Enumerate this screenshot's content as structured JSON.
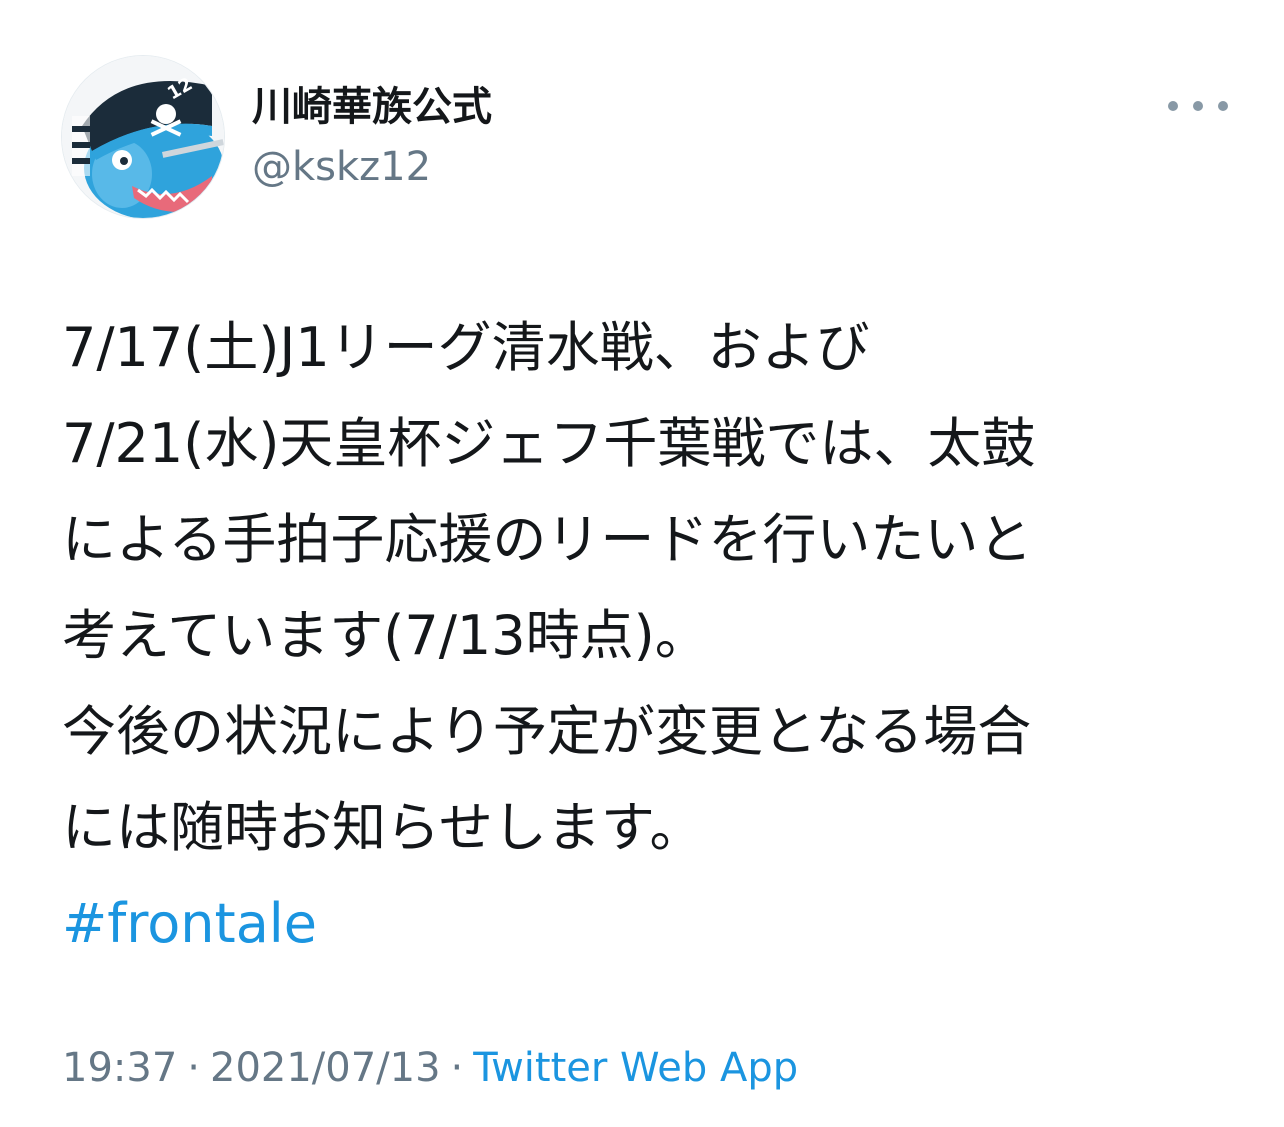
{
  "author": {
    "display_name": "川崎華族公式",
    "handle": "@kskz12",
    "avatar_icon": "pirate-mascot-avatar",
    "avatar_label": "12"
  },
  "more_icon": "more-horizontal-icon",
  "tweet": {
    "lines": [
      "7/17(土)J1リーグ清水戦、および",
      "7/21(水)天皇杯ジェフ千葉戦では、太鼓",
      "による手拍子応援のリードを行いたいと",
      "考えています(7/13時点)。",
      "今後の状況により予定が変更となる場合",
      "には随時お知らせします。"
    ],
    "hashtag": "#frontale"
  },
  "meta": {
    "time": "19:37",
    "separator": "·",
    "date": "2021/07/13",
    "source": "Twitter Web App"
  },
  "colors": {
    "text": "#14171a",
    "secondary": "#657786",
    "link": "#1b95e0",
    "icon": "#8899a6"
  }
}
